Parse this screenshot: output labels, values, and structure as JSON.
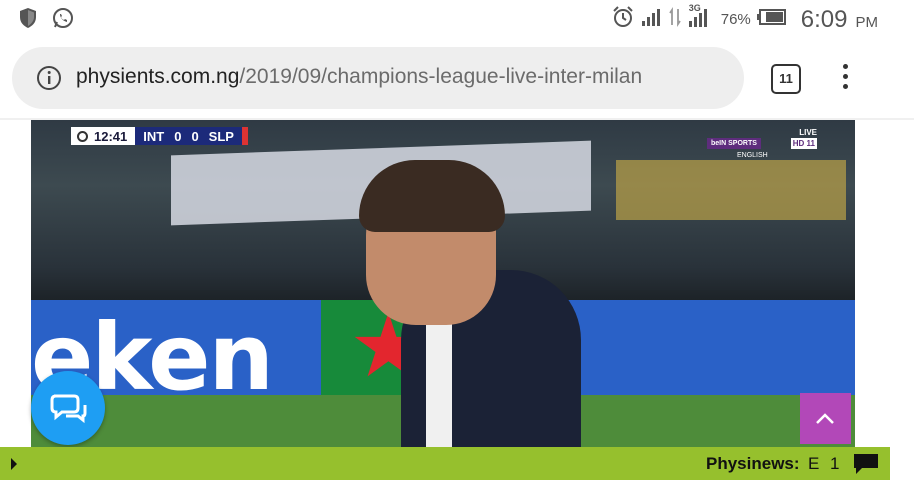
{
  "status_bar": {
    "battery_percent": "76%",
    "network": "3G",
    "time": "6:09",
    "ampm": "PM",
    "icons": [
      "shield-icon",
      "whatsapp-icon",
      "alarm-icon",
      "signal-icon",
      "data-arrows-icon",
      "signal-3g-icon",
      "battery-icon"
    ]
  },
  "browser": {
    "url_domain": "physients.com.ng",
    "url_path": "/2019/09/champions-league-live-inter-milan",
    "tab_count": "11"
  },
  "video": {
    "match_time": "12:41",
    "home_team": "INT",
    "home_score": "0",
    "away_score": "0",
    "away_team": "SLP",
    "live_label": "LIVE",
    "broadcaster": "beIN SPORTS",
    "channel": "HD 11",
    "language": "ENGLISH",
    "ad_text": "eken"
  },
  "ticker": {
    "label": "Physinews:",
    "text": "E",
    "count": "1"
  },
  "colors": {
    "ticker_bg": "#96c02d",
    "chat_fab": "#1e9ef3",
    "scroll_top": "#b248b8",
    "scoreboard": "#1c2a7a"
  }
}
